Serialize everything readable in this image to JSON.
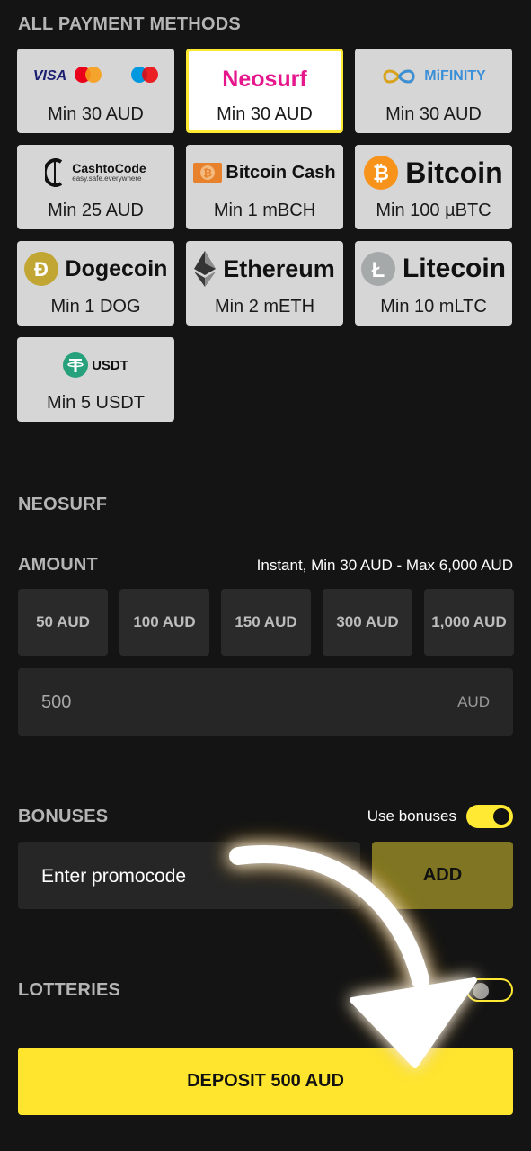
{
  "payment_methods": {
    "title": "ALL PAYMENT METHODS",
    "items": [
      {
        "name": "Visa / Mastercard / Maestro",
        "logo_text": "VISA",
        "min": "Min 30 AUD"
      },
      {
        "name": "Neosurf",
        "logo_text": "Neosurf",
        "min": "Min 30 AUD",
        "selected": true
      },
      {
        "name": "MiFinity",
        "logo_text": "MiFINITY",
        "min": "Min 30 AUD"
      },
      {
        "name": "CashtoCode",
        "logo_text": "CashtoCode",
        "logo_sub": "easy.safe.everywhere",
        "min": "Min 25 AUD"
      },
      {
        "name": "Bitcoin Cash",
        "logo_text": "Bitcoin Cash",
        "min": "Min 1 mBCH"
      },
      {
        "name": "Bitcoin",
        "logo_text": "Bitcoin",
        "min": "Min 100 µBTC"
      },
      {
        "name": "Dogecoin",
        "logo_text": "Dogecoin",
        "min": "Min 1 DOG"
      },
      {
        "name": "Ethereum",
        "logo_text": "Ethereum",
        "min": "Min 2 mETH"
      },
      {
        "name": "Litecoin",
        "logo_text": "Litecoin",
        "min": "Min 10 mLTC"
      },
      {
        "name": "USDT",
        "logo_text": "USDT",
        "min": "Min 5 USDT"
      }
    ]
  },
  "selected_method": {
    "title": "NEOSURF"
  },
  "amount": {
    "title": "AMOUNT",
    "info": "Instant, Min 30 AUD - Max 6,000 AUD",
    "presets": [
      "50 AUD",
      "100 AUD",
      "150 AUD",
      "300 AUD",
      "1,000 AUD"
    ],
    "value": "500",
    "currency": "AUD"
  },
  "bonuses": {
    "title": "BONUSES",
    "toggle_label": "Use bonuses",
    "toggle_on": true,
    "promo_placeholder": "Enter promocode",
    "add_label": "ADD"
  },
  "lotteries": {
    "title": "LOTTERIES",
    "toggle_on": false
  },
  "deposit": {
    "label": "DEPOSIT 500 AUD"
  },
  "colors": {
    "accent": "#ffe933",
    "background": "#141414",
    "neosurf_pink": "#e6168c",
    "mifinity_blue": "#3a8fd9",
    "bitcoin_orange": "#f7931a",
    "doge_gold": "#c2a633",
    "tether_green": "#26a17b"
  }
}
